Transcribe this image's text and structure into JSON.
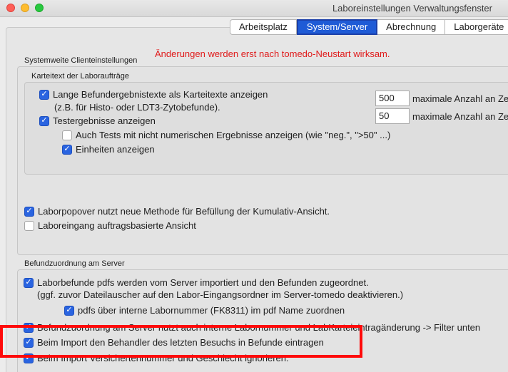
{
  "window": {
    "title": "Laboreinstellungen Verwaltungsfenster"
  },
  "tabs": [
    {
      "label": "Arbeitsplatz",
      "active": false
    },
    {
      "label": "System/Server",
      "active": true
    },
    {
      "label": "Abrechnung",
      "active": false
    },
    {
      "label": "Laborgeräte",
      "active": false
    }
  ],
  "warning_text": "Änderungen werden erst nach tomedo-Neustart wirksam.",
  "systemweite": {
    "label": "Systemweite Clienteinstellungen",
    "karteitext": {
      "label": "Karteitext der Laboraufträge",
      "lange_befund": {
        "label": "Lange Befundergebnistexte als Karteitexte anzeigen",
        "checked": true
      },
      "lange_befund_hint": "(z.B. für Histo- oder LDT3-Zytobefunde).",
      "testergebnisse": {
        "label": "Testergebnisse anzeigen",
        "checked": true
      },
      "auch_tests": {
        "label": "Auch Tests mit nicht numerischen Ergebnisse anzeigen (wie \"neg.\", \">50\" ...)",
        "checked": false
      },
      "einheiten": {
        "label": "Einheiten anzeigen",
        "checked": true
      },
      "max1": {
        "value": "500",
        "label": "maximale Anzahl an Ze"
      },
      "max2": {
        "value": "50",
        "label": "maximale Anzahl an Ze"
      }
    },
    "laborpopover": {
      "label": "Laborpopover nutzt neue Methode für Befüllung der Kumulativ-Ansicht.",
      "checked": true
    },
    "laboreingang": {
      "label": "Laboreingang auftragsbasierte Ansicht",
      "checked": false
    }
  },
  "befundzuordnung": {
    "label": "Befundzuordnung am Server",
    "pdfs_import": {
      "label": "Laborbefunde pdfs werden vom Server importiert und den Befunden zugeordnet.",
      "checked": true
    },
    "pdfs_import_hint": "(ggf. zuvor Dateilauscher auf den Labor-Eingangsordner im Server-tomedo deaktivieren.)",
    "pdfs_labornummer": {
      "label": "pdfs über interne Labornummer (FK8311) im pdf Name zuordnen",
      "checked": true
    },
    "befundzuordnung_filter": {
      "label": "Befundzuordnung am Server nutzt auch interne Labornummer und LabKarteieintragänderung -> Filter unten",
      "checked": true
    },
    "behandler_import": {
      "label": "Beim Import den Behandler des letzten Besuchs in Befunde eintragen",
      "checked": true
    },
    "versicherten": {
      "label": "Beim Import Versichertennummer und Geschlecht ignorieren.",
      "checked": true
    }
  },
  "colors": {
    "accent": "#2a64e0",
    "warning": "#e01b1b",
    "highlight": "#ff0a0a"
  }
}
